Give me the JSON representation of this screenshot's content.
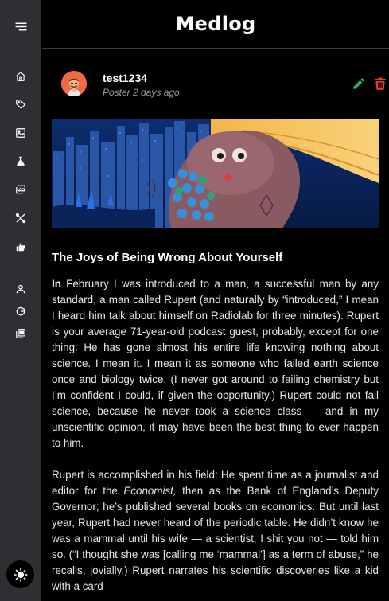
{
  "header": {
    "title": "Medlog"
  },
  "sidebar": {
    "items": [
      {
        "name": "home",
        "icon": "home-icon"
      },
      {
        "name": "tag",
        "icon": "tag-icon"
      },
      {
        "name": "image",
        "icon": "image-icon"
      },
      {
        "name": "lab",
        "icon": "flask-icon"
      },
      {
        "name": "images",
        "icon": "images-icon"
      },
      {
        "name": "tools",
        "icon": "tools-icon"
      },
      {
        "name": "hand",
        "icon": "hand-icon"
      },
      {
        "name": "profile",
        "icon": "user-icon"
      },
      {
        "name": "logout",
        "icon": "logout-icon"
      },
      {
        "name": "gallery",
        "icon": "gallery-icon"
      }
    ],
    "theme_icon": "sun-icon"
  },
  "post": {
    "username": "test1234",
    "meta": "Poster 2 days ago",
    "title": "The Joys of Being Wrong About Yourself",
    "p1_lead": "In",
    "p1_text": " February I was introduced to a man, a successful man by any standard, a man called Rupert (and naturally by “introduced,” I mean I heard him talk about himself on Radiolab for three minutes). Rupert is your average 71-year-old podcast guest, probably, except for one thing: He has gone almost his entire life knowing nothing about science. I mean it. I mean it as someone who failed earth science once and biology twice. (I never got around to failing chemistry but I’m confident I could, if given the opportunity.) Rupert could not fail science, because he never took a science class — and in my unscientific opinion, it may have been the best thing to ever happen to him.",
    "p2_a": "Rupert is accomplished in his field: He spent time as a journalist and editor for the ",
    "p2_em": "Economist,",
    "p2_b": " then as the Bank of England’s Deputy Governor; he’s published several books on economics. But until last year, Rupert had never heard of the periodic table. He didn’t know he was a mammal until his wife — a scientist, I shit you not — told him so. (“I thought she was [calling me ‘mammal’] as a term of abuse,” he recalls, jovially.) Rupert narrates his scientific discoveries like a kid with a card",
    "actions": {
      "edit_icon": "pencil-icon",
      "delete_icon": "trash-icon"
    },
    "colors": {
      "edit": "#27ae60",
      "delete": "#e53935"
    }
  }
}
